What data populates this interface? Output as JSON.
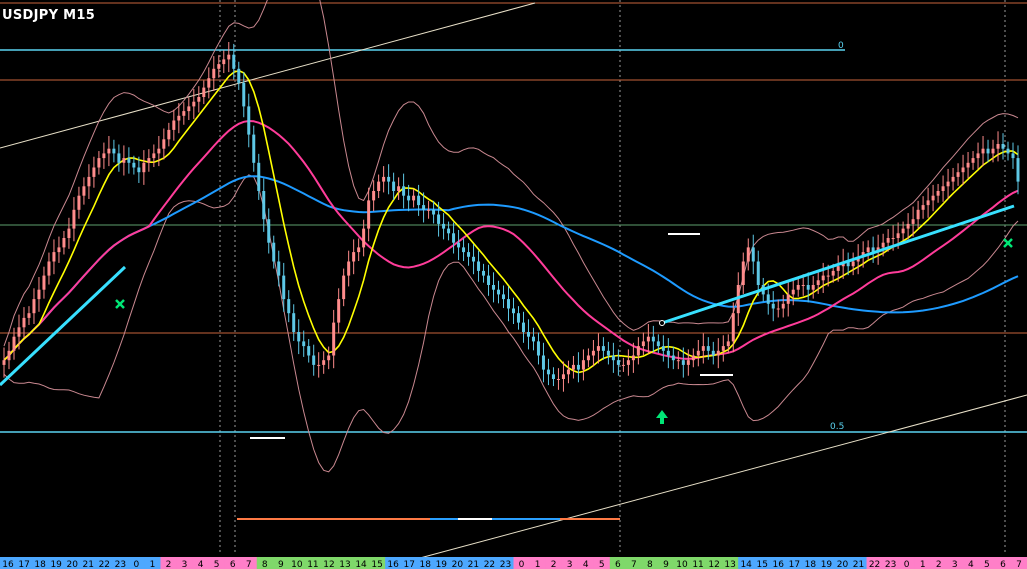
{
  "header": {
    "title": "USDJPY M15"
  },
  "fib_levels": [
    {
      "label": "0",
      "value": 1.0
    },
    {
      "label": "0.5",
      "value": 0.5
    }
  ],
  "colors": {
    "background": "#000000",
    "bull_candle": "#ff8c8c",
    "bear_candle": "#5ec8e6",
    "sma_yellow": "#ffff00",
    "sma_magenta": "#ff3c9a",
    "sma_blue": "#1e9bff",
    "trendline_cyan": "#38e0ff",
    "bands": "#c98890",
    "fib_line": "#5ad2f0",
    "horizontal_level": "#c8643c",
    "mid_level": "#5ea06e",
    "signal_arrow": "#00e676"
  },
  "chart_data": {
    "type": "candlestick",
    "symbol": "USDJPY",
    "timeframe": "M15",
    "x_hour_labels": [
      "16",
      "17",
      "18",
      "19",
      "20",
      "21",
      "22",
      "23",
      "0",
      "1",
      "2",
      "3",
      "4",
      "5",
      "6",
      "7",
      "8",
      "9",
      "10",
      "11",
      "12",
      "13",
      "14",
      "15",
      "16",
      "17",
      "18",
      "19",
      "20",
      "21",
      "22",
      "23",
      "0",
      "1",
      "2",
      "3",
      "4",
      "5",
      "6",
      "7",
      "8",
      "9",
      "10",
      "11",
      "12",
      "13",
      "14",
      "15",
      "16",
      "17",
      "18",
      "19",
      "20",
      "21",
      "22",
      "23",
      "0",
      "1",
      "2",
      "3",
      "4",
      "5",
      "6",
      "7"
    ],
    "ylim": [
      0,
      100
    ],
    "close": [
      34,
      36,
      39,
      41,
      43,
      44,
      47,
      49,
      52,
      55,
      57,
      58,
      60,
      62,
      66,
      69,
      71,
      73,
      75,
      77,
      78,
      79,
      78,
      76,
      77,
      76,
      75,
      74,
      76,
      77,
      78,
      79,
      81,
      83,
      85,
      86,
      87,
      88,
      89,
      90,
      92,
      94,
      96,
      97,
      98,
      99,
      96,
      93,
      88,
      82,
      76,
      70,
      64,
      59,
      55,
      52,
      47,
      44,
      40,
      38,
      37,
      35,
      33,
      33,
      34,
      35,
      42,
      47,
      52,
      55,
      57,
      58,
      62,
      68,
      70,
      72,
      73,
      72,
      70,
      71,
      69,
      68,
      69,
      67,
      66,
      66,
      65,
      63,
      62,
      61,
      59,
      58,
      57,
      56,
      55,
      53,
      52,
      50,
      49,
      48,
      47,
      45,
      44,
      42,
      40,
      39,
      38,
      35,
      32,
      31,
      30,
      30,
      31,
      32,
      33,
      32,
      34,
      35,
      36,
      37,
      36,
      35,
      34,
      33,
      33,
      34,
      35,
      37,
      38,
      39,
      38,
      37,
      36,
      35,
      34,
      34,
      33,
      34,
      35,
      36,
      37,
      36,
      35,
      36,
      37,
      38,
      44,
      50,
      55,
      58,
      55,
      50,
      48,
      46,
      45,
      45,
      46,
      48,
      49,
      50,
      50,
      49,
      50,
      51,
      52,
      52,
      53,
      54,
      55,
      54,
      55,
      56,
      57,
      58,
      57,
      58,
      59,
      60,
      60,
      61,
      62,
      63,
      64,
      66,
      67,
      68,
      69,
      70,
      71,
      72,
      73,
      74,
      75,
      76,
      77,
      78,
      79,
      78,
      79,
      80,
      79,
      78,
      77,
      72
    ],
    "overlays": [
      "sma_fast_yellow",
      "sma_mid_magenta",
      "sma_slow_blue",
      "bollinger_bands",
      "cyan_trendlines",
      "fibonacci_0_0.5"
    ],
    "markers": [
      {
        "type": "cross",
        "color": "green"
      },
      {
        "type": "up-arrow",
        "color": "green"
      },
      {
        "type": "cross",
        "color": "green"
      }
    ],
    "grid": false
  }
}
